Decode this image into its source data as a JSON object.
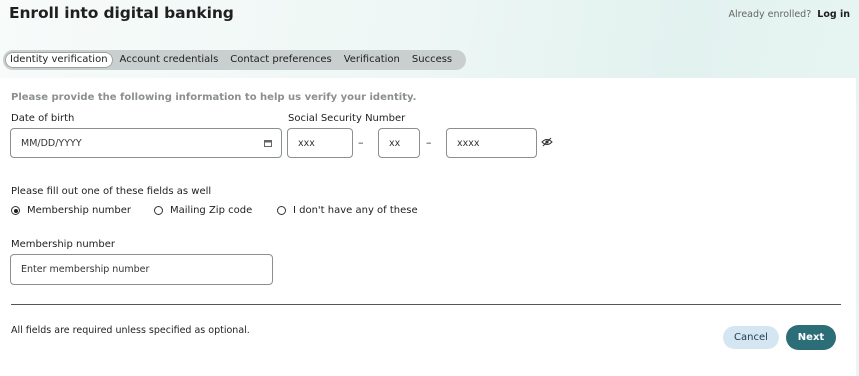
{
  "header": {
    "title": "Enroll into digital banking",
    "already_text": "Already enrolled?",
    "login_label": "Log in"
  },
  "steps": [
    {
      "label": "Identity verification",
      "active": true
    },
    {
      "label": "Account credentials",
      "active": false
    },
    {
      "label": "Contact preferences",
      "active": false
    },
    {
      "label": "Verification",
      "active": false
    },
    {
      "label": "Success",
      "active": false
    }
  ],
  "form": {
    "intro": "Please provide the following information to help us verify your identity.",
    "dob": {
      "label": "Date of birth",
      "placeholder": "MM/DD/YYYY",
      "value": "",
      "icon": "calendar-icon"
    },
    "ssn": {
      "label": "Social Security Number",
      "part1_placeholder": "xxx",
      "part2_placeholder": "xx",
      "part3_placeholder": "xxxx",
      "separator": "–",
      "toggle_icon": "eye-icon"
    },
    "one_of_label": "Please fill out one of these fields as well",
    "options": [
      {
        "label": "Membership number",
        "checked": true
      },
      {
        "label": "Mailing Zip code",
        "checked": false
      },
      {
        "label": "I don't have any of these",
        "checked": false
      }
    ],
    "membership": {
      "label": "Membership number",
      "placeholder": "Enter membership number",
      "value": ""
    }
  },
  "footer": {
    "note": "All fields are required unless specified as optional.",
    "cancel_label": "Cancel",
    "next_label": "Next"
  },
  "colors": {
    "primary": "#2c6e78",
    "secondary_button": "#d3e6f1",
    "stepper_bg": "#c9cfce"
  }
}
